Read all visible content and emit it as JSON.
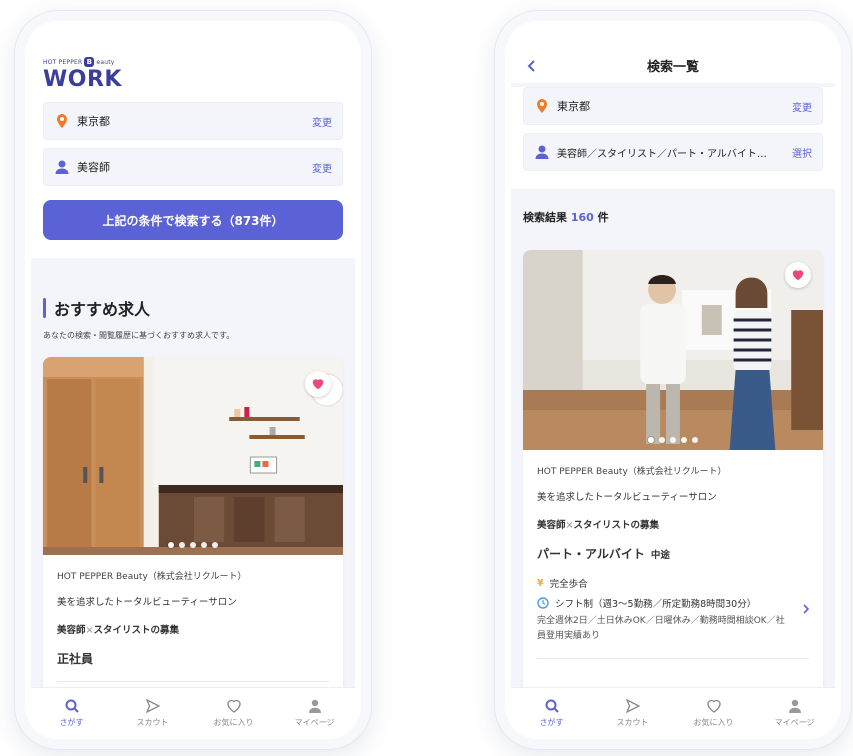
{
  "left": {
    "logo_small": "HOT PEPPER",
    "logo_b": "B",
    "logo_small_suffix": "eauty",
    "logo_work": "WORK",
    "location": {
      "label": "東京都",
      "action": "変更"
    },
    "occupation": {
      "label": "美容師",
      "action": "変更"
    },
    "search_button": "上記の条件で検索する（873件）",
    "section_title": "おすすめ求人",
    "section_sub": "あなたの検索・閲覧履歴に基づくおすすめ求人です。",
    "card": {
      "company": "HOT PEPPER Beauty（株式会社リクルート）",
      "catch": "美を追求したトータルビューティーサロン",
      "job_a": "美容師",
      "job_x": "×",
      "job_b": "スタイリストの募集",
      "employment": "正社員"
    }
  },
  "right": {
    "nav_title": "検索一覧",
    "location": {
      "label": "東京都",
      "action": "変更"
    },
    "occupation": {
      "label": "美容師／スタイリスト／パート・アルバイト…",
      "action": "選択"
    },
    "result_prefix": "検索結果",
    "result_count": "160",
    "result_suffix": "件",
    "card": {
      "company": "HOT PEPPER Beauty（株式会社リクルート）",
      "catch": "美を追求したトータルビューティーサロン",
      "job_a": "美容師",
      "job_x": "×",
      "job_b": "スタイリストの募集",
      "employment": "パート・アルバイト",
      "employment_sub": "中途",
      "salary": "完全歩合",
      "shift": "シフト制（週3〜5勤務／所定勤務8時間30分）",
      "holiday": "完全週休2日／土日休みOK／日曜休み／勤務時間相談OK／社員登用実績あり"
    }
  },
  "tabs": [
    {
      "label": "さがす",
      "icon": "search-icon"
    },
    {
      "label": "スカウト",
      "icon": "send-icon"
    },
    {
      "label": "お気に入り",
      "icon": "heart-icon"
    },
    {
      "label": "マイページ",
      "icon": "user-icon"
    }
  ],
  "colors": {
    "accent": "#5b62d6",
    "pin": "#f07a2a",
    "heart": "#e84a7a",
    "brand": "#3b3f99"
  }
}
